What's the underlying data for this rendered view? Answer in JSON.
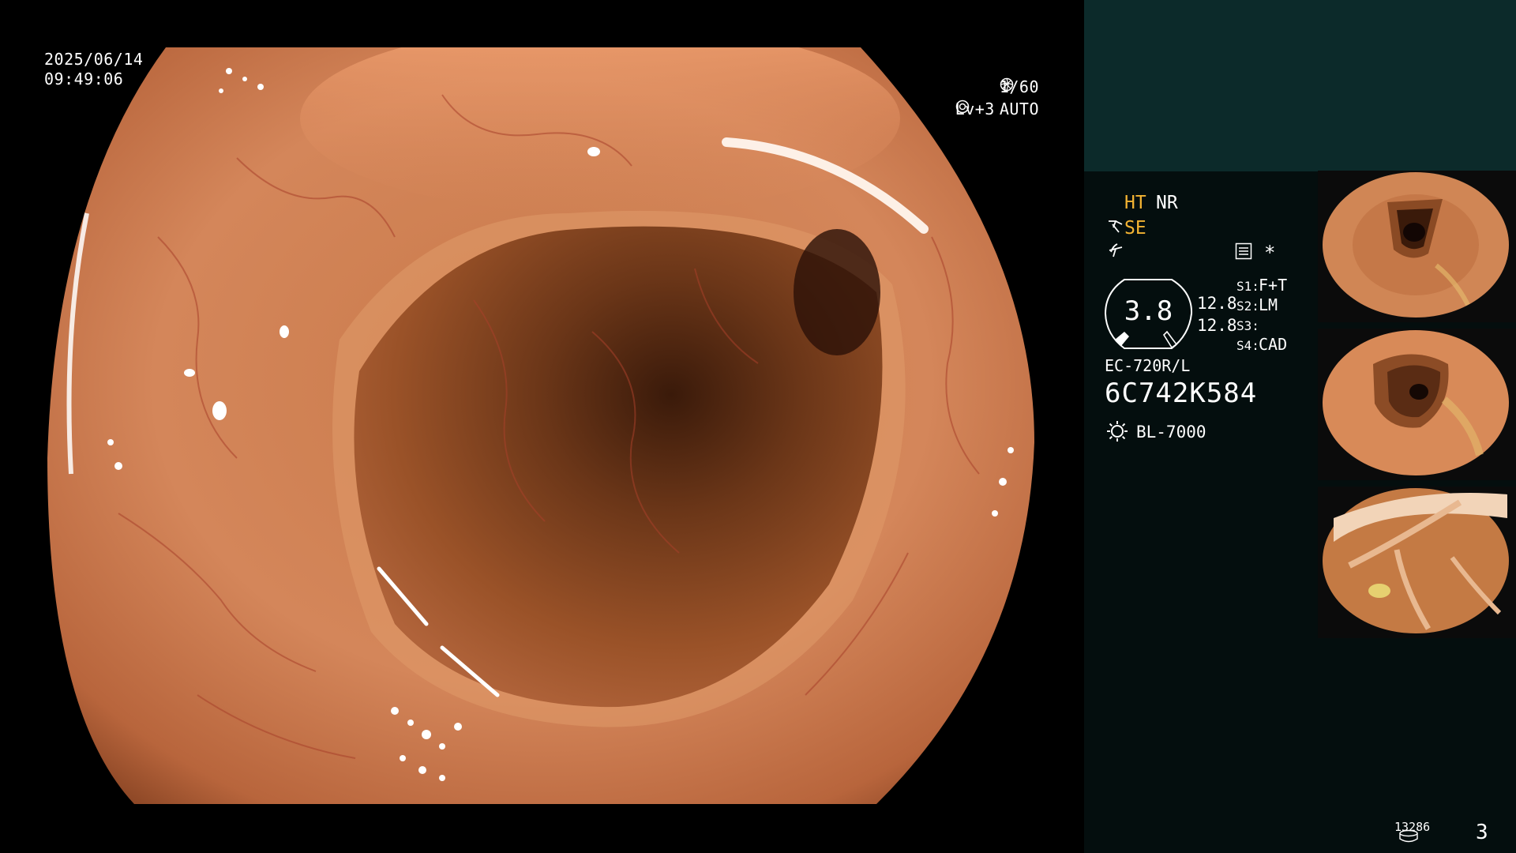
{
  "feed": {
    "date": "2025/06/14",
    "time": "09:49:06",
    "shutter": "1/60",
    "shutter_icon": "aperture-icon",
    "level": "Lv+3",
    "mode": "AUTO",
    "mode_icon": "iris-icon"
  },
  "panel": {
    "ht": "HT",
    "nr": "NR",
    "se": "SE",
    "star": "*",
    "gauge_value": "3.8",
    "readout_1": "12.8",
    "readout_2": "12.8",
    "switches": [
      {
        "label": "S1:",
        "value": "F+T"
      },
      {
        "label": "S2:",
        "value": "LM"
      },
      {
        "label": "S3:",
        "value": ""
      },
      {
        "label": "S4:",
        "value": "CAD"
      }
    ],
    "scope_model": "EC-720R/L",
    "scope_serial": "6C742K584",
    "light_source": "BL-7000",
    "image_count": "13286",
    "page_number": "3"
  },
  "colors": {
    "accent_orange": "#f4b433",
    "panel_top": "#0c2a2a",
    "panel_bg": "#040e0e"
  }
}
